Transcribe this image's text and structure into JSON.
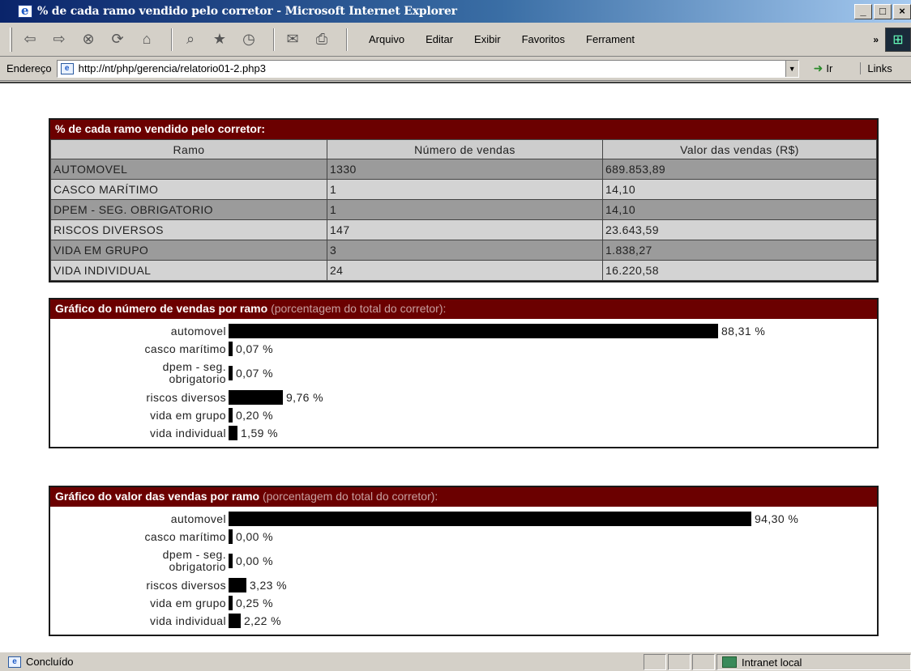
{
  "window": {
    "title": "% de cada ramo vendido pelo corretor - Microsoft Internet Explorer",
    "minimize": "_",
    "maximize": "□",
    "close": "×"
  },
  "toolbar": {
    "menu": [
      "Arquivo",
      "Editar",
      "Exibir",
      "Favoritos",
      "Ferrament"
    ],
    "chevron": "»",
    "icons": [
      "back-icon",
      "forward-icon",
      "stop-icon",
      "refresh-icon",
      "home-icon",
      "search-icon",
      "favorites-icon",
      "history-icon",
      "mail-icon",
      "print-icon"
    ]
  },
  "address": {
    "label": "Endereço",
    "url": "http://nt/php/gerencia/relatorio01-2.php3",
    "go_label": "Ir",
    "links_label": "Links"
  },
  "summary": {
    "title": "% de cada ramo vendido pelo corretor:",
    "headers": [
      "Ramo",
      "Número de vendas",
      "Valor das vendas (R$)"
    ],
    "rows": [
      [
        "AUTOMOVEL",
        "1330",
        "689.853,89"
      ],
      [
        "CASCO MARÍTIMO",
        "1",
        "14,10"
      ],
      [
        "DPEM - SEG. OBRIGATORIO",
        "1",
        "14,10"
      ],
      [
        "RISCOS DIVERSOS",
        "147",
        "23.643,59"
      ],
      [
        "VIDA EM GRUPO",
        "3",
        "1.838,27"
      ],
      [
        "VIDA INDIVIDUAL",
        "24",
        "16.220,58"
      ]
    ]
  },
  "chart_data": [
    {
      "type": "bar",
      "title": "Gráfico do número de vendas por ramo",
      "subtitle": "(porcentagem do total do corretor):",
      "categories": [
        "automovel",
        "casco marítimo",
        "dpem - seg. obrigatorio",
        "riscos diversos",
        "vida em grupo",
        "vida individual"
      ],
      "values": [
        88.31,
        0.07,
        0.07,
        9.76,
        0.2,
        1.59
      ],
      "labels": [
        "88,31 %",
        "0,07 %",
        "0,07 %",
        "9,76 %",
        "0,20 %",
        "1,59 %"
      ],
      "xlim": [
        0,
        100
      ],
      "orientation": "horizontal"
    },
    {
      "type": "bar",
      "title": "Gráfico do valor das vendas por ramo",
      "subtitle": "(porcentagem do total do corretor):",
      "categories": [
        "automovel",
        "casco marítimo",
        "dpem - seg. obrigatorio",
        "riscos diversos",
        "vida em grupo",
        "vida individual"
      ],
      "values": [
        94.3,
        0.0,
        0.0,
        3.23,
        0.25,
        2.22
      ],
      "labels": [
        "94,30 %",
        "0,00 %",
        "0,00 %",
        "3,23 %",
        "0,25 %",
        "2,22 %"
      ],
      "xlim": [
        0,
        100
      ],
      "orientation": "horizontal"
    }
  ],
  "status": {
    "text": "Concluído",
    "zone": "Intranet local"
  }
}
